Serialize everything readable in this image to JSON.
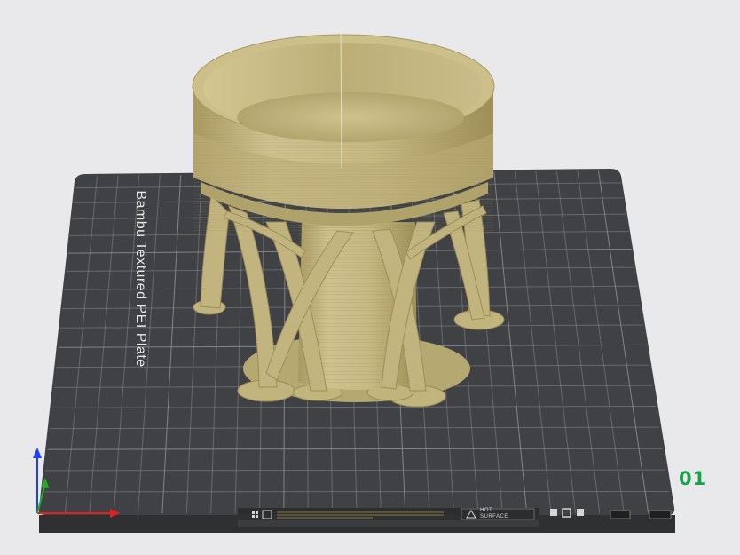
{
  "plate": {
    "label": "Bambu Textured PEI Plate",
    "index": "01",
    "index_color": "#17a34a",
    "surface_color": "#3f4144",
    "grid_color": "#8d9094"
  },
  "model": {
    "filament_color": "#c8bb86",
    "description_icon": "cylindrical-pot-with-tree-supports"
  },
  "strip": {
    "left_text": "HOT",
    "right_text": "SURFACE"
  },
  "icons": {
    "axes": "xyz-axes-icon",
    "grid_icon": "plate-grid-icon",
    "image_icon": "plate-image-icon",
    "lock_icon": "lock-icon",
    "upload_icon": "upload-icon",
    "square_icon": "square-icon",
    "delete_icon": "trash-icon"
  }
}
